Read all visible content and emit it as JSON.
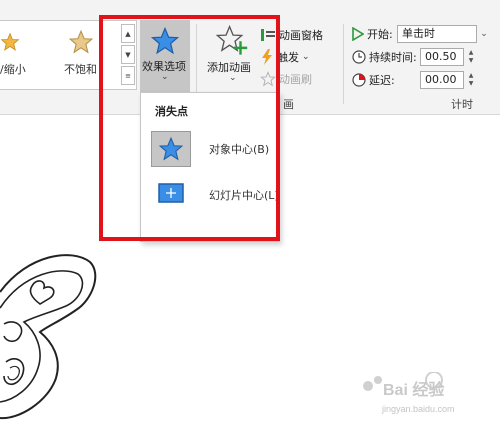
{
  "ribbon": {
    "gallery": {
      "items": [
        {
          "label": "/缩小",
          "icon": "grow-shrink-star-icon"
        },
        {
          "label": "不饱和",
          "icon": "desaturate-star-icon"
        }
      ],
      "scroll_up": "▲",
      "scroll_down": "▼",
      "expand": "≡"
    },
    "effect_options": {
      "label": "效果选项",
      "icon": "effect-options-star-icon",
      "chevron": "⌄"
    },
    "add_animation": {
      "label": "添加动画",
      "icon": "add-animation-star-icon",
      "chevron": "⌄"
    },
    "animation_pane": {
      "label": "动画窗格",
      "icon": "animation-pane-icon"
    },
    "trigger": {
      "label": "触发",
      "icon": "lightning-icon",
      "chevron": "⌄"
    },
    "animation_painter": {
      "label": "动画刷",
      "icon": "animation-painter-icon"
    },
    "advanced_group_label": "画",
    "timing": {
      "start_label": "开始:",
      "start_value": "单击时",
      "duration_label": "持续时间:",
      "duration_value": "00.50",
      "delay_label": "延迟:",
      "delay_value": "00.00",
      "group_label": "计时"
    }
  },
  "dropdown": {
    "header": "消失点",
    "items": [
      {
        "label": "对象中心(B)",
        "icon": "object-center-star-icon",
        "selected": true
      },
      {
        "label": "幻灯片中心(L)",
        "icon": "slide-center-icon",
        "selected": false
      }
    ]
  },
  "colors": {
    "highlight_border": "#e0131b",
    "star_blue": "#3a8ee6",
    "star_gold": "#f0b840",
    "selected_bg": "#c6c6c6"
  },
  "watermark": {
    "text": "Bai 经验",
    "url": "jingyan.baidu.com"
  }
}
